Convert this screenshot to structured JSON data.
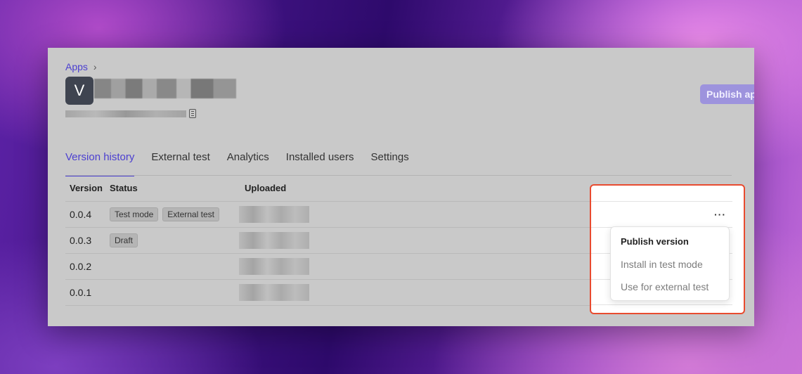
{
  "breadcrumb": {
    "apps_label": "Apps",
    "chevron": "›"
  },
  "app": {
    "icon_letter": "V"
  },
  "header": {
    "publish_label": "Publish app"
  },
  "tabs": [
    {
      "label": "Version history",
      "active": true
    },
    {
      "label": "External test"
    },
    {
      "label": "Analytics"
    },
    {
      "label": "Installed users"
    },
    {
      "label": "Settings"
    }
  ],
  "table": {
    "headers": {
      "version": "Version",
      "status": "Status",
      "uploaded": "Uploaded"
    },
    "rows": [
      {
        "version": "0.0.4",
        "badges": [
          "Test mode",
          "External test"
        ]
      },
      {
        "version": "0.0.3",
        "badges": [
          "Draft"
        ]
      },
      {
        "version": "0.0.2",
        "badges": []
      },
      {
        "version": "0.0.1",
        "badges": []
      }
    ]
  },
  "row_menu": {
    "trigger": "···",
    "items": [
      "Publish version",
      "Install in test mode",
      "Use for external test"
    ]
  },
  "colors": {
    "accent": "#4b3fd0",
    "highlight_border": "#e84b2f",
    "publish_button": "#9d93dd"
  }
}
